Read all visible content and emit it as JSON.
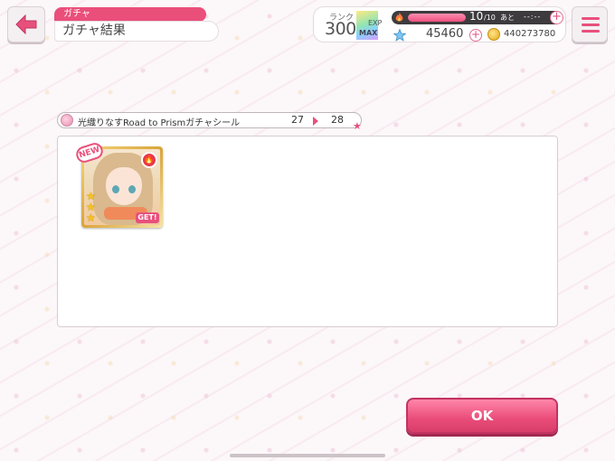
{
  "header": {
    "category": "ガチャ",
    "title": "ガチャ結果"
  },
  "status": {
    "rank_label": "ランク",
    "rank_value": "300",
    "exp_label": "EXP",
    "max_label": "MAX",
    "energy_current": "10",
    "energy_max": "/10",
    "energy_next_label": "あと",
    "energy_timer": "--:--",
    "energy_fraction": 1.0,
    "stars": "45460",
    "coins": "440273780"
  },
  "gacha_info": {
    "name": "光織りなすRoad to Prismガチャシール",
    "count_before": "27",
    "count_after": "28"
  },
  "results": [
    {
      "new_label": "NEW",
      "get_label": "GET!",
      "rarity": 3,
      "attribute": "fire"
    }
  ],
  "buttons": {
    "ok_label": "OK"
  },
  "colors": {
    "accent": "#e8507c",
    "background": "#fcf7f9"
  }
}
